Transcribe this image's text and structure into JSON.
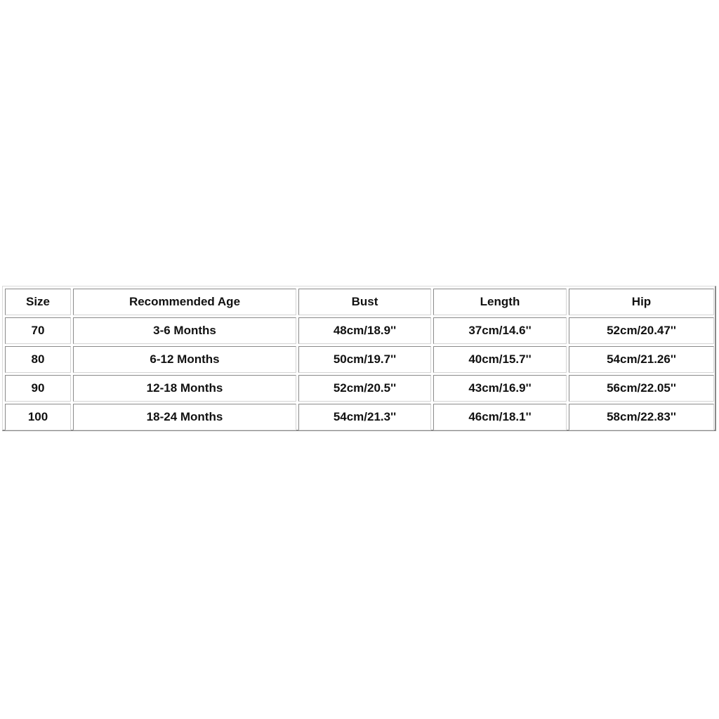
{
  "size_chart": {
    "headers": [
      "Size",
      "Recommended Age",
      "Bust",
      "Length",
      "Hip"
    ],
    "rows": [
      [
        "70",
        "3-6 Months",
        "48cm/18.9''",
        "37cm/14.6''",
        "52cm/20.47''"
      ],
      [
        "80",
        "6-12 Months",
        "50cm/19.7''",
        "40cm/15.7''",
        "54cm/21.26''"
      ],
      [
        "90",
        "12-18 Months",
        "52cm/20.5''",
        "43cm/16.9''",
        "56cm/22.05''"
      ],
      [
        "100",
        "18-24 Months",
        "54cm/21.3''",
        "46cm/18.1''",
        "58cm/22.83''"
      ]
    ]
  }
}
